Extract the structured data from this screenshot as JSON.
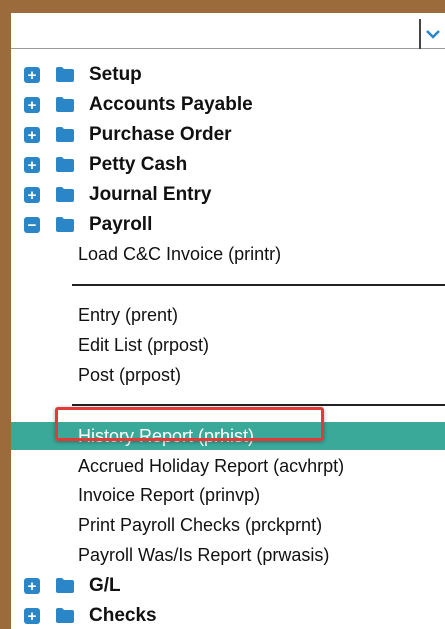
{
  "dropdown": {
    "value": ""
  },
  "tree": {
    "setup": "Setup",
    "accounts_payable": "Accounts Payable",
    "purchase_order": "Purchase Order",
    "petty_cash": "Petty Cash",
    "journal_entry": "Journal Entry",
    "payroll": "Payroll",
    "gl": "G/L",
    "checks": "Checks"
  },
  "payroll_items": {
    "load_cc_invoice": "Load C&C Invoice (printr)",
    "entry": "Entry (prent)",
    "edit_list": "Edit List (prpost)",
    "post": "Post (prpost)",
    "history_report": "History Report (prhist)",
    "accrued_holiday": "Accrued Holiday Report (acvhrpt)",
    "invoice_report": "Invoice Report (prinvp)",
    "print_checks": "Print Payroll Checks (prckprnt)",
    "was_is_report": "Payroll Was/Is Report (prwasis)"
  },
  "icons": {
    "expand": "plus-icon",
    "collapse": "minus-icon",
    "folder": "folder-icon",
    "dropdown": "chevron-down-icon"
  },
  "colors": {
    "accent": "#2b86c7",
    "selected": "#3ba99a",
    "highlight": "#e53935"
  }
}
